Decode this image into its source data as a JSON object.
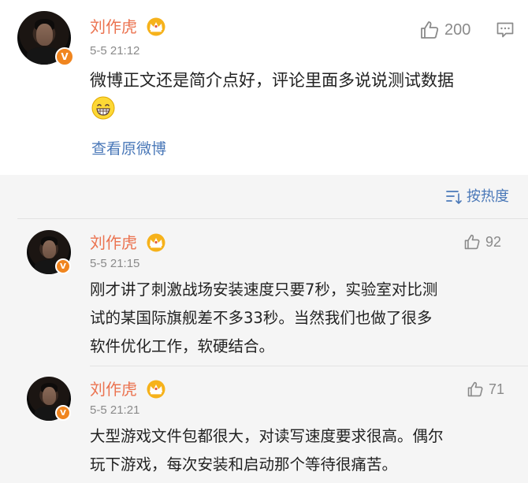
{
  "post": {
    "author": "刘作虎",
    "time": "5-5 21:12",
    "likes": "200",
    "text": "微博正文还是简介点好，评论里面多说说测试数据",
    "view_original": "查看原微博",
    "verified_badge": "V"
  },
  "sort": {
    "label": "按热度"
  },
  "comments": [
    {
      "author": "刘作虎",
      "time": "5-5 21:15",
      "likes": "92",
      "lines": [
        "刚才讲了刺激战场安装速度只要7秒，实验室对比测",
        "试的某国际旗舰差不多33秒。当然我们也做了很多",
        "软件优化工作，软硬结合。"
      ],
      "verified_badge": "V"
    },
    {
      "author": "刘作虎",
      "time": "5-5 21:21",
      "likes": "71",
      "lines": [
        "大型游戏文件包都很大，对读写速度要求很高。偶尔",
        "玩下游戏，每次安装和启动那个等待很痛苦。"
      ],
      "verified_badge": "V"
    }
  ],
  "colors": {
    "name": "#eb7350",
    "link": "#4a78b8",
    "meta": "#8a8a8a",
    "badge": "#f0851f",
    "comments_bg": "#f5f5f5"
  }
}
